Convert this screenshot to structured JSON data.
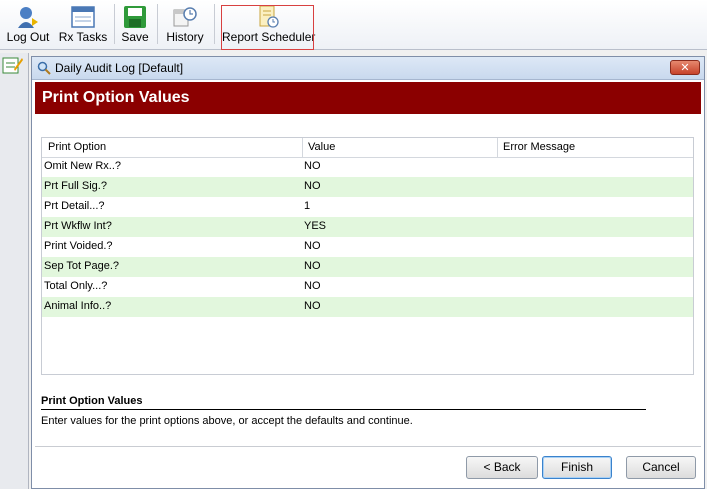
{
  "toolbar": {
    "buttons": [
      {
        "label": "Log Out",
        "icon": "log-out-icon"
      },
      {
        "label": "Rx Tasks",
        "icon": "rx-tasks-icon"
      },
      {
        "label": "Save",
        "icon": "save-icon"
      },
      {
        "label": "History",
        "icon": "history-icon"
      },
      {
        "label": "Report Scheduler",
        "icon": "report-scheduler-icon"
      }
    ]
  },
  "dialog": {
    "title": "Daily Audit Log [Default]",
    "close_label": "✕",
    "header": "Print Option Values",
    "columns": [
      "Print Option",
      "Value",
      "Error Message"
    ],
    "rows": [
      {
        "option": "Omit New Rx..?",
        "value": "NO",
        "error": ""
      },
      {
        "option": "Prt Full Sig.?",
        "value": "NO",
        "error": ""
      },
      {
        "option": "Prt Detail...?",
        "value": "1",
        "error": ""
      },
      {
        "option": "Prt Wkflw Int?",
        "value": "YES",
        "error": ""
      },
      {
        "option": "Print Voided.?",
        "value": "NO",
        "error": ""
      },
      {
        "option": "Sep Tot Page.?",
        "value": "NO",
        "error": ""
      },
      {
        "option": "Total Only...?",
        "value": "NO",
        "error": ""
      },
      {
        "option": "Animal Info..?",
        "value": "NO",
        "error": ""
      }
    ],
    "description_title": "Print Option Values",
    "description_text": "Enter values for the print options above, or accept the defaults and continue.",
    "buttons": {
      "back": "< Back",
      "finish": "Finish",
      "cancel": "Cancel"
    }
  },
  "colors": {
    "header_band": "#8b0000",
    "alt_row": "#e2f7dd",
    "highlight_border": "#d84040"
  }
}
